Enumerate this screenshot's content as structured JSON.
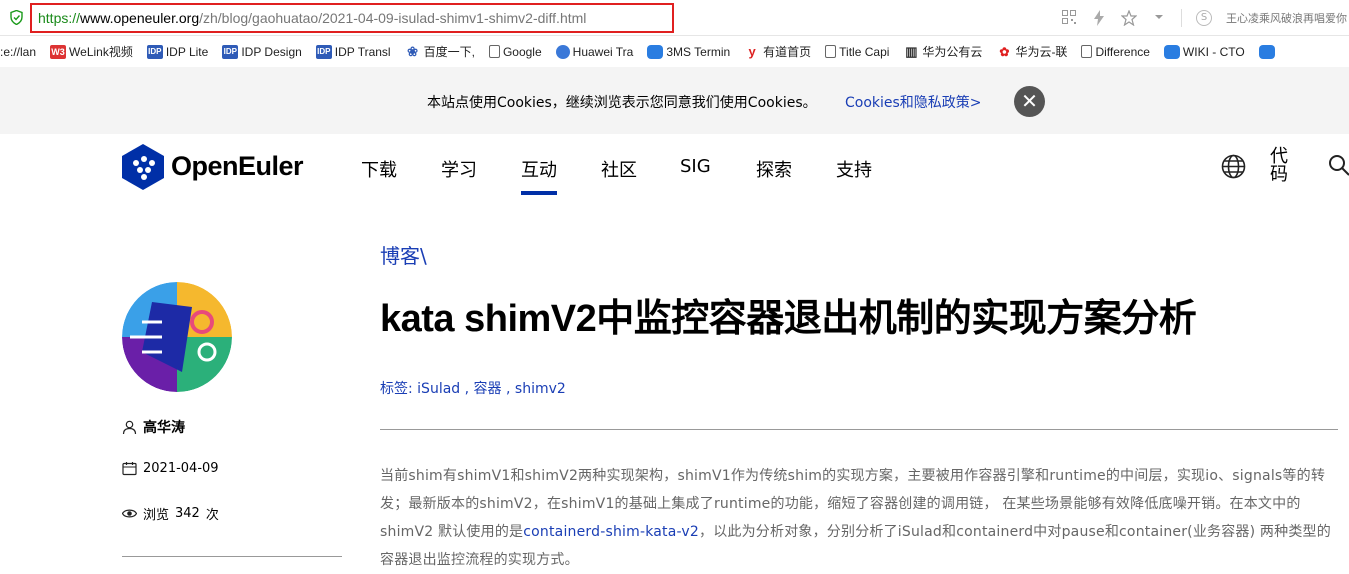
{
  "browser": {
    "url_scheme": "https://",
    "url_host": "www.openeuler.org",
    "url_path": "/zh/blog/gaohuatao/2021-04-09-isulad-shimv1-shimv2-diff.html",
    "extension_text": "王心凌乘风破浪再唱爱你",
    "toolbar_icons": [
      "qr-code-icon",
      "bolt-icon",
      "star-icon",
      "chevron-down-icon",
      "s-search-icon"
    ]
  },
  "bookmarks": [
    {
      "label": ":e://lan",
      "icon": "none"
    },
    {
      "label": "WeLink视频",
      "icon": "w3"
    },
    {
      "label": "IDP Lite",
      "icon": "idp"
    },
    {
      "label": "IDP Design",
      "icon": "idp"
    },
    {
      "label": "IDP Transl",
      "icon": "idp"
    },
    {
      "label": "百度一下,",
      "icon": "paw"
    },
    {
      "label": "Google",
      "icon": "doc"
    },
    {
      "label": "Huawei Tra",
      "icon": "globe"
    },
    {
      "label": "3MS Termin",
      "icon": "cloud"
    },
    {
      "label": "有道首页",
      "icon": "red"
    },
    {
      "label": "Title Capi",
      "icon": "doc"
    },
    {
      "label": "华为公有云",
      "icon": "book"
    },
    {
      "label": "华为云-联",
      "icon": "huawei"
    },
    {
      "label": "Difference",
      "icon": "doc"
    },
    {
      "label": "WIKI - CTO",
      "icon": "cloud"
    }
  ],
  "cookie": {
    "text": "本站点使用Cookies，继续浏览表示您同意我们使用Cookies。",
    "link": "Cookies和隐私政策>",
    "close": "✕"
  },
  "nav": {
    "logo_text": "OpenEuler",
    "items": [
      "下载",
      "学习",
      "互动",
      "社区",
      "SIG",
      "探索",
      "支持"
    ],
    "active": "互动",
    "lang_label": "代码"
  },
  "sidebar": {
    "author": "高华涛",
    "date": "2021-04-09",
    "views_prefix": "浏览",
    "views_count": "342",
    "views_suffix": "次"
  },
  "article": {
    "breadcrumb": "博客\\",
    "title": "kata shimV2中监控容器退出机制的实现方案分析",
    "tags_label": "标签:",
    "tags": [
      "iSulad",
      "容器",
      "shimv2"
    ],
    "body_part1": "当前shim有shimV1和shimV2两种实现架构，shimV1作为传统shim的实现方案，主要被用作容器引擎和runtime的中间层，实现io、signals等的转发；最新版本的shimV2，在shimV1的基础上集成了runtime的功能，缩短了容器创建的调用链， 在某些场景能够有效降低底噪开销。在本文中的shimV2 默认使用的是",
    "body_link": "containerd-shim-kata-v2",
    "body_part2": "，以此为分析对象，分别分析了iSulad和containerd中对pause和container(业务容器) 两种类型的容器退出监控流程的实现方式。"
  }
}
